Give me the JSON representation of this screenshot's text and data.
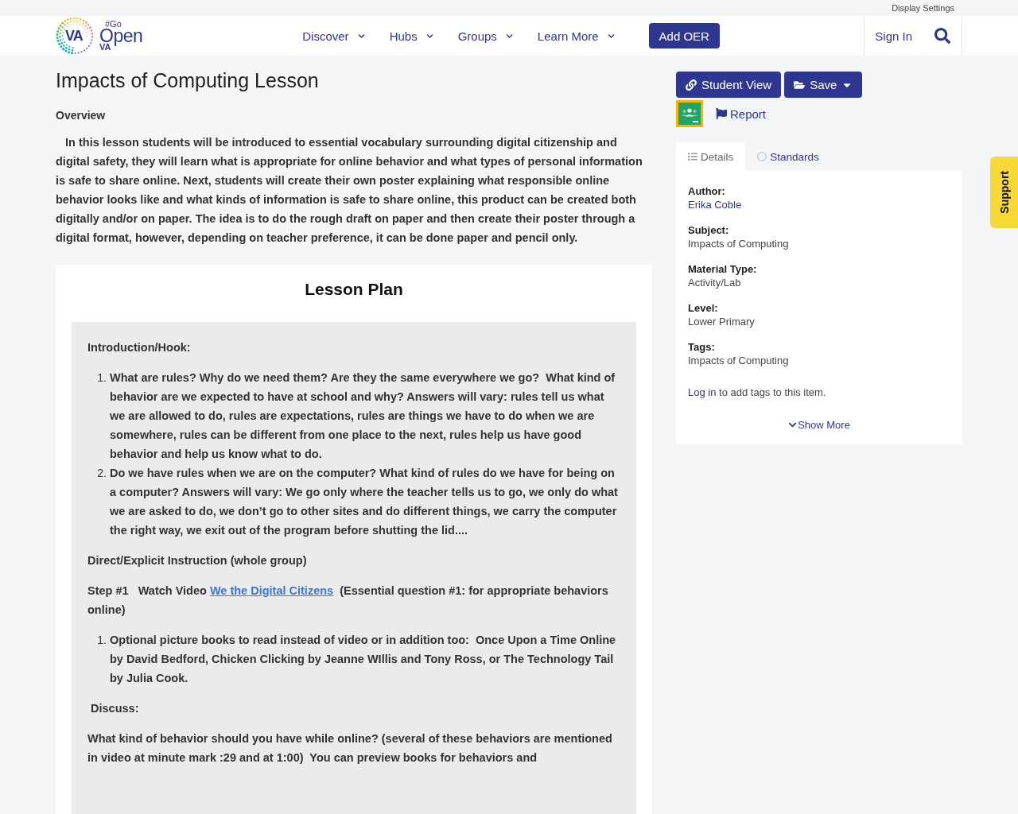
{
  "top_bar": {
    "display_settings": "Display Settings"
  },
  "nav": {
    "logo": {
      "badge": "VA",
      "hashtag": "#Go",
      "word": "Open",
      "state": "VA"
    },
    "menu": [
      {
        "label": "Discover",
        "kind": "dropdown"
      },
      {
        "label": "Hubs",
        "kind": "dropdown"
      },
      {
        "label": "Groups",
        "kind": "dropdown"
      },
      {
        "label": "Learn More",
        "kind": "dropdown"
      }
    ],
    "add_button": "Add OER",
    "sign_in": "Sign In"
  },
  "page": {
    "title": "Impacts of Computing Lesson",
    "overview_heading": "Overview",
    "overview": "   In this lesson students will be introduced to essential vocabulary surrounding digital citizenship and digital safety, they will learn what is appropriate for online behavior and what types of personal information is safe to share online. Next, students will create their own poster explaining what responsible online behavior looks like and what kinds of information is safe to share online, this product can be created both digitally and/or on paper. The idea is to do the rough draft on paper and then create their poster through a digital format, however, depending on teacher preference, it can be done paper and pencil only."
  },
  "lesson_plan": {
    "title": "Lesson Plan",
    "blocks": [
      {
        "kind": "heading",
        "text": "Introduction/Hook:"
      },
      {
        "kind": "list",
        "items": [
          {
            "marker": "1.",
            "text": "What are rules? Why do we need them? Are they the same everywhere we go?  What kind of behavior are we expected to have at school and why? Answers will vary: rules tell us what we are allowed to do, rules are expectations, rules are things we have to do when we are somewhere, rules can be different from one place to the next, rules help us have good behavior and help us know what to do."
          },
          {
            "marker": "2.",
            "text": "Do we have rules when we are on the computer? What kind of rules do we have for being on a computer? Answers will vary: We go only where the teacher tells us to go, we only do what we are asked to do, we don’t go to other sites and do different things, we carry the computer the right way, we exit out of the program before shutting the lid...."
          }
        ]
      },
      {
        "kind": "heading",
        "text": "Direct/Explicit Instruction (whole group)"
      },
      {
        "kind": "paragraph",
        "text": "Step #1   Watch Video ",
        "link": "We the Digital Citizens",
        "after": "  (Essential question #1: for appropriate behaviors online)"
      },
      {
        "kind": "list",
        "items": [
          {
            "marker": "1.",
            "text": "Optional picture books to read instead of video or in addition too:  Once Upon a Time Online by David Bedford, Chicken Clicking by Jeanne WIllis and Tony Ross, or The Technology Tail by Julia Cook."
          }
        ]
      },
      {
        "kind": "heading",
        "text": " Discuss:"
      },
      {
        "kind": "paragraph",
        "text": "What kind of behavior should you have while online? (several of these behaviors are mentioned in video at minute mark :29 and at 1:00)  You can preview books for behaviors and"
      }
    ]
  },
  "sidebar": {
    "student_view": "Student View",
    "save": "Save",
    "report": "Report",
    "tabs": [
      {
        "label": "Details",
        "selected": true
      },
      {
        "label": "Standards",
        "selected": false
      }
    ],
    "details": [
      {
        "label": "Author:",
        "value": "Erika Coble",
        "kind": "link"
      },
      {
        "label": "Subject:",
        "value": "Impacts of Computing",
        "kind": "text"
      },
      {
        "label": "Material Type:",
        "value": "Activity/Lab",
        "kind": "text"
      },
      {
        "label": "Level:",
        "value": "Lower Primary",
        "kind": "text"
      },
      {
        "label": "Tags:",
        "value": "Impacts of Computing",
        "kind": "text"
      }
    ],
    "tags_note": {
      "link": "Log in",
      "text": " to add tags to this item."
    },
    "show_more": "Show More"
  },
  "support": "Support"
}
